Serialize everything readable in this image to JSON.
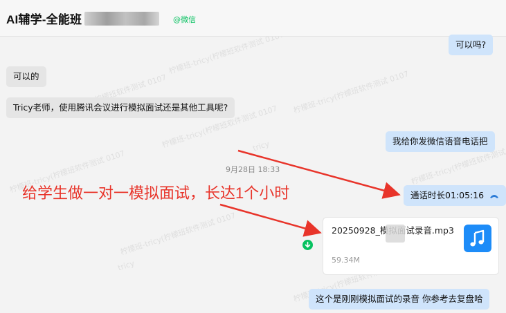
{
  "header": {
    "title": "AI辅学-全能班",
    "source": "@微信"
  },
  "messages": {
    "m1": "可以吗?",
    "m2": "可以的",
    "m3": "Tricy老师，使用腾讯会议进行模拟面试还是其他工具呢?",
    "m4": "我给你发微信语音电话把",
    "time": "9月28日 18:33",
    "call": "通话时长01:05:16",
    "last": "这个是刚刚模拟面试的录音  你参考去复盘哈"
  },
  "file": {
    "name_a": "20250928_",
    "name_b": "模拟面试录音.mp3",
    "size": "59.34M"
  },
  "overlay": {
    "text": "给学生做一对一模拟面试，长达1个小时"
  },
  "watermark": {
    "line1": "柠檬班-tricy(柠檬班软件测试 0107",
    "line2": "tricy"
  },
  "colors": {
    "accent_green": "#07c160",
    "annotation_red": "#e8342a",
    "out_bubble": "#cfe4fb",
    "file_icon": "#1d8cf8"
  },
  "icons": {
    "call": "phone-icon",
    "file": "music-note-icon",
    "download": "download-icon"
  }
}
